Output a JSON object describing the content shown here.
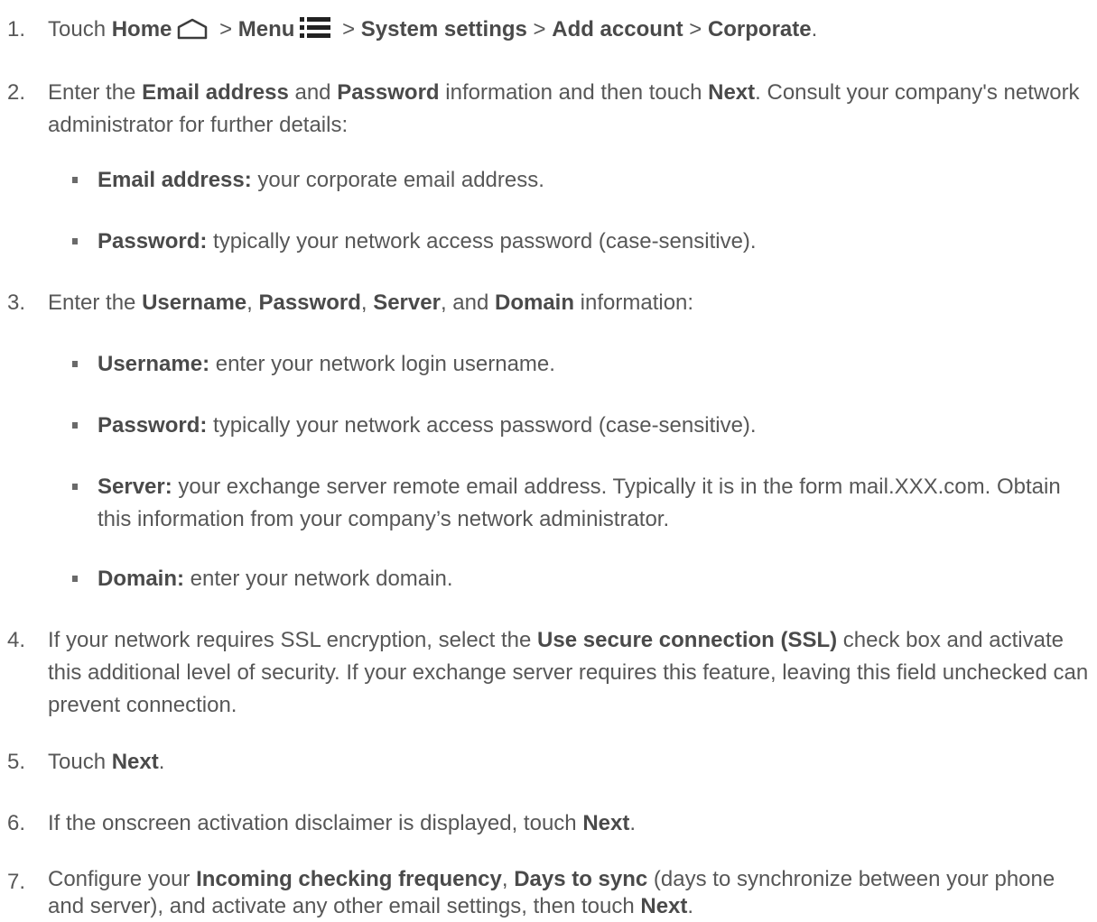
{
  "steps": [
    {
      "num": "1.",
      "parts": [
        {
          "t": "Touch "
        },
        {
          "b": "Home"
        },
        {
          "icon": "home-icon"
        },
        {
          "t": " > "
        },
        {
          "b": "Menu"
        },
        {
          "icon": "menu-icon"
        },
        {
          "t": " > "
        },
        {
          "b": "System settings"
        },
        {
          "t": " > "
        },
        {
          "b": "Add account"
        },
        {
          "t": " > "
        },
        {
          "b": "Corporate"
        },
        {
          "t": "."
        }
      ]
    },
    {
      "num": "2.",
      "parts": [
        {
          "t": "Enter the "
        },
        {
          "b": "Email address"
        },
        {
          "t": " and "
        },
        {
          "b": "Password"
        },
        {
          "t": " information and then touch "
        },
        {
          "b": "Next"
        },
        {
          "t": ". Consult your company's network administrator for further details:"
        }
      ],
      "bullets": [
        [
          {
            "b": "Email address:"
          },
          {
            "t": " your corporate email address."
          }
        ],
        [
          {
            "b": "Password:"
          },
          {
            "t": " typically your network access password (case-sensitive)."
          }
        ]
      ]
    },
    {
      "num": "3.",
      "parts": [
        {
          "t": "Enter the "
        },
        {
          "b": "Username"
        },
        {
          "t": ", "
        },
        {
          "b": "Password"
        },
        {
          "t": ", "
        },
        {
          "b": "Server"
        },
        {
          "t": ", and "
        },
        {
          "b": "Domain"
        },
        {
          "t": " information:"
        }
      ],
      "bullets": [
        [
          {
            "b": "Username:"
          },
          {
            "t": " enter your network login username."
          }
        ],
        [
          {
            "b": "Password:"
          },
          {
            "t": " typically your network access password (case-sensitive)."
          }
        ],
        [
          {
            "b": "Server:"
          },
          {
            "t": " your exchange server remote email address. Typically it is in the form mail.XXX.com. Obtain this information from your company’s network administrator."
          }
        ],
        [
          {
            "b": "Domain:"
          },
          {
            "t": " enter your network domain."
          }
        ]
      ]
    },
    {
      "num": "4.",
      "parts": [
        {
          "t": "If your network requires SSL encryption, select the "
        },
        {
          "b": "Use secure connection (SSL)"
        },
        {
          "t": " check box and activate this additional level of security. If your exchange server requires this feature, leaving this field unchecked can prevent connection."
        }
      ]
    },
    {
      "num": "5.",
      "parts": [
        {
          "t": "Touch "
        },
        {
          "b": "Next"
        },
        {
          "t": "."
        }
      ]
    },
    {
      "num": "6.",
      "parts": [
        {
          "t": "If the onscreen activation disclaimer is displayed, touch "
        },
        {
          "b": "Next"
        },
        {
          "t": "."
        }
      ]
    },
    {
      "num": "7.",
      "parts": [
        {
          "t": "Configure your "
        },
        {
          "b": "Incoming checking frequency"
        },
        {
          "t": ", "
        },
        {
          "b": "Days to sync"
        },
        {
          "t": " (days to synchronize between your phone and server), and activate any other email settings, then touch "
        },
        {
          "b": "Next"
        },
        {
          "t": "."
        }
      ]
    }
  ]
}
